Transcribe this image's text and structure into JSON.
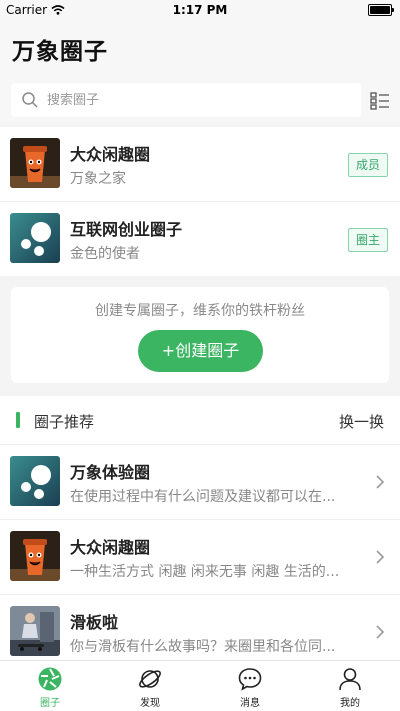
{
  "status_bar": {
    "carrier": "Carrier",
    "time": "1:17 PM"
  },
  "header": {
    "title": "万象圈子"
  },
  "search": {
    "placeholder": "搜索圈子"
  },
  "my_circles": [
    {
      "name": "大众闲趣圈",
      "desc": "万象之家",
      "badge": "成员",
      "avatar": "cup-icon"
    },
    {
      "name": "互联网创业圈子",
      "desc": "金色的使者",
      "badge": "圈主",
      "avatar": "bubbles-icon"
    }
  ],
  "create": {
    "text": "创建专属圈子，维系你的铁杆粉丝",
    "button": "+创建圈子"
  },
  "recommend": {
    "title": "圈子推荐",
    "refresh": "换一换",
    "items": [
      {
        "name": "万象体验圈",
        "desc": "在使用过程中有什么问题及建议都可以在...",
        "avatar": "bubbles-icon"
      },
      {
        "name": "大众闲趣圈",
        "desc": "一种生活方式 闲趣 闲来无事 闲趣 生活的...",
        "avatar": "cup-icon"
      },
      {
        "name": "滑板啦",
        "desc": "你与滑板有什么故事吗？来圈里和各位同...",
        "avatar": "skate-photo"
      }
    ]
  },
  "tabs": [
    {
      "label": "圈子",
      "icon": "circle-aperture-icon",
      "active": true
    },
    {
      "label": "发现",
      "icon": "planet-icon",
      "active": false
    },
    {
      "label": "消息",
      "icon": "chat-bubble-icon",
      "active": false
    },
    {
      "label": "我的",
      "icon": "user-icon",
      "active": false
    }
  ],
  "colors": {
    "accent": "#3bb562",
    "badge_text": "#34a86c",
    "background": "#f4f4f4"
  }
}
